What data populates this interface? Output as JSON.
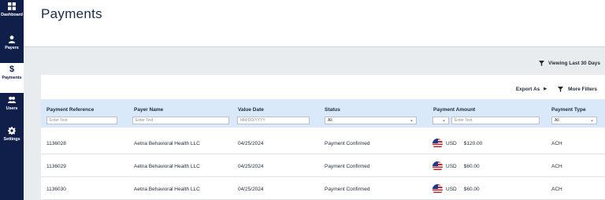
{
  "sidebar": {
    "items": [
      {
        "label": "Dashboard",
        "icon": "dashboard-icon"
      },
      {
        "label": "Payers",
        "icon": "person-icon"
      },
      {
        "label": "Payments",
        "icon": "dollar-icon"
      },
      {
        "label": "Users",
        "icon": "users-icon"
      },
      {
        "label": "Settings",
        "icon": "gear-icon"
      }
    ],
    "active": "Payments",
    "colors": {
      "background": "#0f1f4a",
      "active_background": "#ffffff"
    }
  },
  "header": {
    "title": "Payments"
  },
  "viewing_filter": {
    "label": "Viewing Last 30 Days",
    "icon": "filter-icon"
  },
  "toolbar": {
    "export_label": "Export As",
    "more_filters_label": "More Filters"
  },
  "table": {
    "columns": [
      {
        "label": "Payment Reference",
        "filter": {
          "type": "text",
          "placeholder": "Enter Text"
        }
      },
      {
        "label": "Payer Name",
        "filter": {
          "type": "text",
          "placeholder": "Enter Text"
        }
      },
      {
        "label": "Value Date",
        "filter": {
          "type": "text",
          "placeholder": "MM/DD/YYYY"
        }
      },
      {
        "label": "Status",
        "filter": {
          "type": "select",
          "value": "All"
        }
      },
      {
        "label": "Payment Amount",
        "filter": {
          "type": "select+text",
          "value": "",
          "placeholder": "Enter Text"
        }
      },
      {
        "label": "Payment Type",
        "filter": {
          "type": "select",
          "value": "All"
        }
      }
    ],
    "rows": [
      {
        "reference": "1136028",
        "payer": "Aetna Behavioral Health LLC",
        "date": "04/25/2024",
        "status": "Payment Confirmed",
        "currency": "USD",
        "amount": "$120.00",
        "type": "ACH"
      },
      {
        "reference": "1136029",
        "payer": "Aetna Behavioral Health LLC",
        "date": "04/25/2024",
        "status": "Payment Confirmed",
        "currency": "USD",
        "amount": "$60.00",
        "type": "ACH"
      },
      {
        "reference": "1136030",
        "payer": "Aetna Behavioral Health LLC",
        "date": "04/25/2024",
        "status": "Payment Confirmed",
        "currency": "USD",
        "amount": "$60.00",
        "type": "ACH"
      }
    ],
    "header_row_color": "#d9e9fa"
  }
}
